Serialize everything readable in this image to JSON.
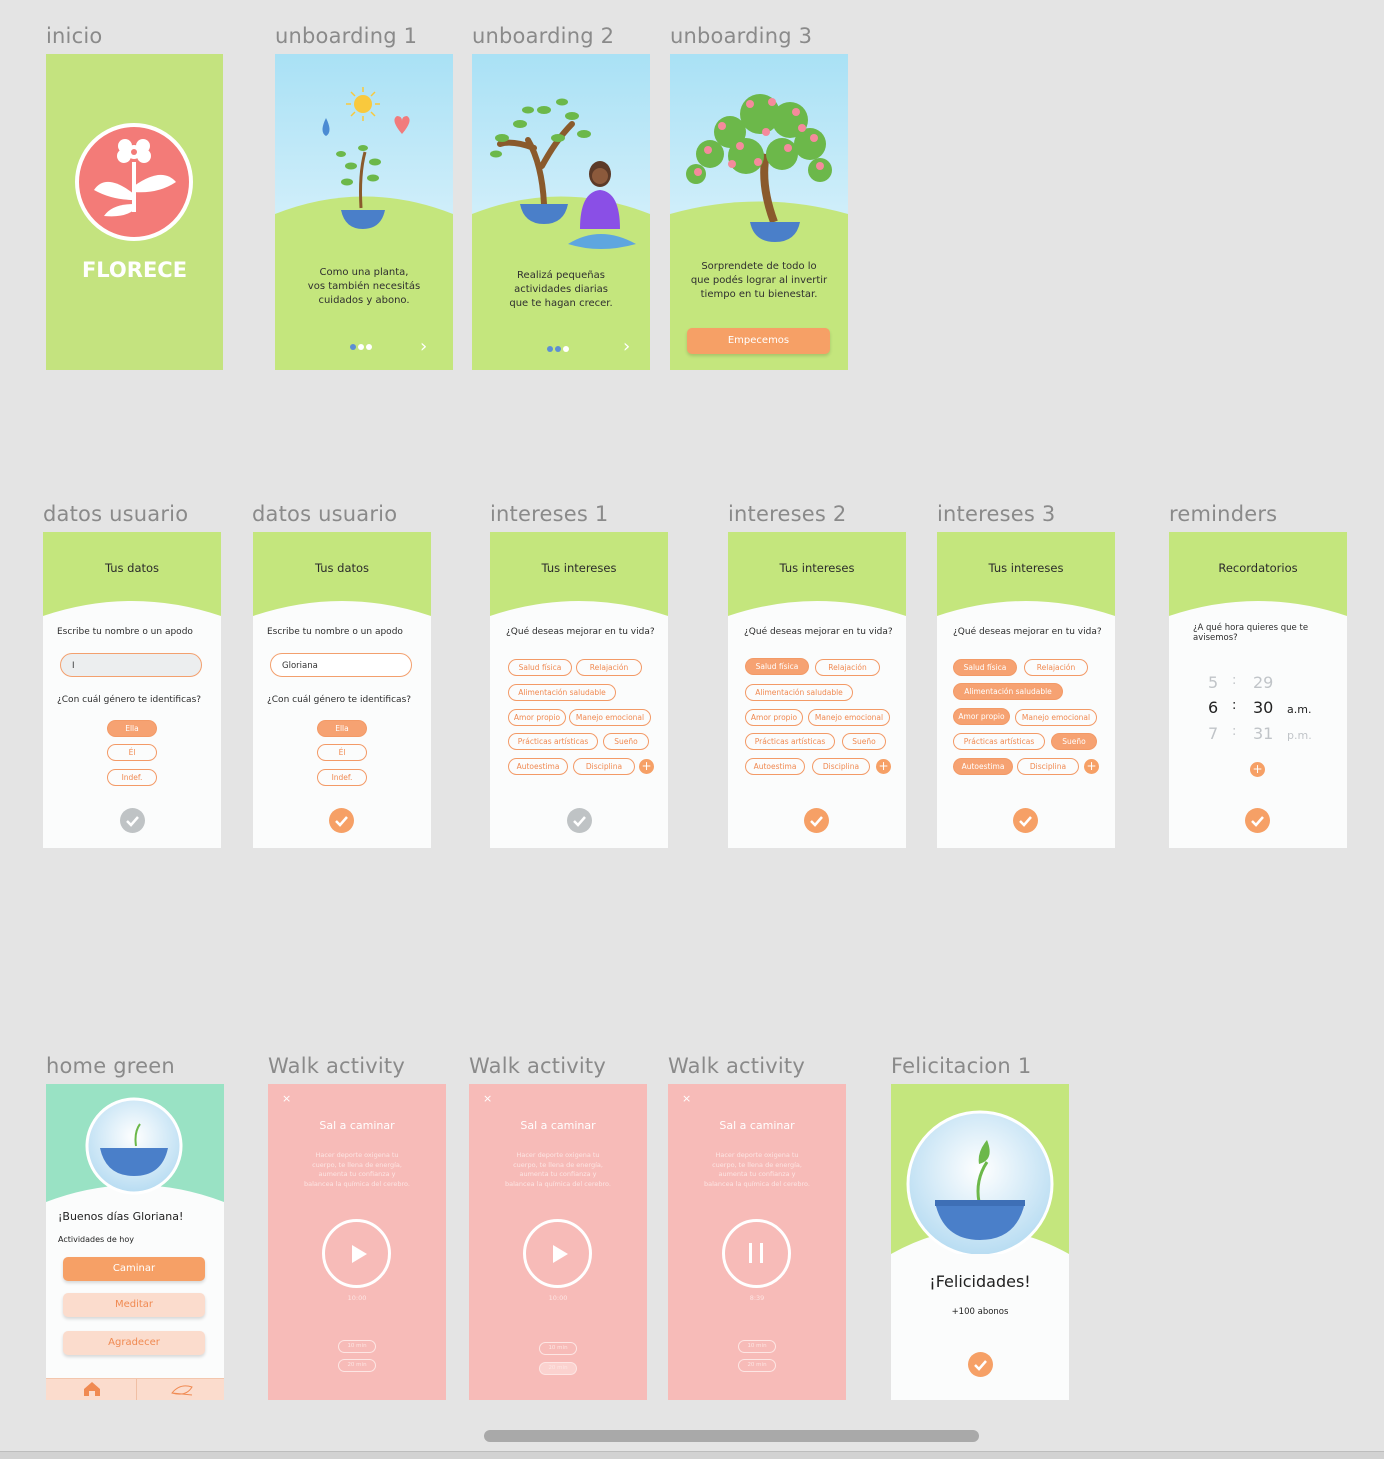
{
  "artboards": {
    "inicio": "inicio",
    "unboarding1": "unboarding 1",
    "unboarding2": "unboarding 2",
    "unboarding3": "unboarding 3",
    "datos1": "datos usuario",
    "datos2": "datos usuario",
    "intereses1": "intereses 1",
    "intereses2": "intereses 2",
    "intereses3": "intereses 3",
    "reminders": "reminders",
    "home": "home green",
    "walk1": "Walk activity",
    "walk2": "Walk activity",
    "walk3": "Walk activity",
    "felicitacion": "Felicitacion 1"
  },
  "splash": {
    "brand": "FLORECE"
  },
  "onboarding": {
    "text1": [
      "Como una planta,",
      "vos también necesitás",
      "cuidados y abono."
    ],
    "text2": [
      "Realizá pequeñas",
      "actividades diarias",
      "que te hagan crecer."
    ],
    "text3": [
      "Sorprendete de todo lo",
      "que podés lograr al invertir",
      "tiempo en tu bienestar."
    ],
    "start_button": "Empecemos",
    "next_icon": "chevron-right-icon"
  },
  "datos": {
    "title": "Tus datos",
    "name_label": "Escribe tu nombre o un apodo",
    "name_value_empty": "I",
    "name_value": "Gloriana",
    "gender_label": "¿Con cuál género te identificas?",
    "genders": [
      "Ella",
      "Él",
      "Indef."
    ]
  },
  "intereses": {
    "title": "Tus intereses",
    "question": "¿Qué deseas mejorar en tu vida?",
    "options": [
      "Salud física",
      "Relajación",
      "Alimentación saludable",
      "Amor propio",
      "Manejo emocional",
      "Prácticas artísticas",
      "Sueño",
      "Autoestima",
      "Disciplina"
    ],
    "add": "+"
  },
  "reminders": {
    "title": "Recordatorios",
    "question": "¿A qué hora quieres que te avisemos?",
    "hours": [
      "5",
      "6",
      "7"
    ],
    "minutes": [
      "29",
      "30",
      "31"
    ],
    "ampm": [
      "a.m.",
      "p.m."
    ],
    "sep": ":"
  },
  "home": {
    "greeting": "¡Buenos días Gloriana!",
    "subtitle": "Actividades de hoy",
    "activities": [
      "Caminar",
      "Meditar",
      "Agradecer"
    ]
  },
  "walk": {
    "close": "×",
    "title": "Sal a caminar",
    "description": "Hacer deporte oxigena tu cuerpo, te llena de energía, aumenta tu confianza y balancea la química del cerebro.",
    "time_a": "10:00",
    "time_b": "10:00",
    "time_c": "8:39",
    "opt1": "10 min",
    "opt2": "20 min"
  },
  "felicitacion": {
    "title": "¡Felicidades!",
    "reward": "+100 abonos"
  },
  "colors": {
    "green": "#c3e57c",
    "orange": "#f6a066",
    "coral": "#f47c78",
    "pink": "#f7bbb8",
    "mint": "#99e2c4",
    "blue": "#4a7fc9"
  }
}
